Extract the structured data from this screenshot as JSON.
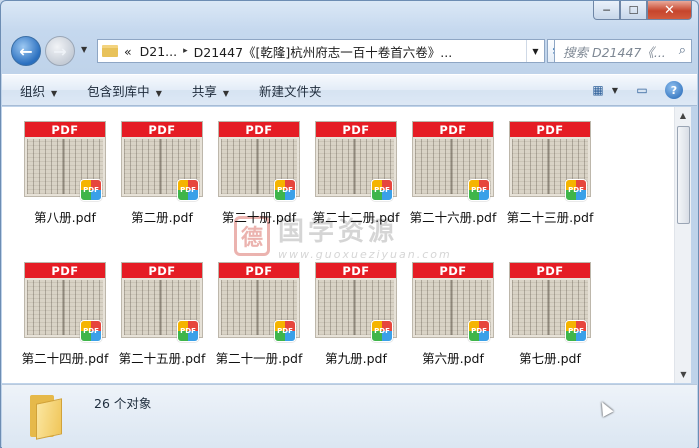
{
  "window": {
    "minimize": "─",
    "maximize": "☐",
    "close": "✕"
  },
  "nav": {
    "back_glyph": "←",
    "forward_glyph": "→",
    "history_dropdown": "▼",
    "breadcrumb": {
      "overflow": "«",
      "crumb1": "D21...",
      "crumb2": "D21447《[乾隆]杭州府志一百十卷首六卷》...",
      "separator": "▸"
    },
    "address_dropdown": "▼",
    "refresh_glyph": "⇆",
    "search_placeholder": "搜索 D21447《...",
    "search_icon": "⌕"
  },
  "toolbar": {
    "organize": "组织",
    "include_library": "包含到库中",
    "share": "共享",
    "new_folder": "新建文件夹",
    "dropdown_arrow": "▼",
    "view_icon": "▦",
    "view_dropdown": "▼",
    "pane_icon": "▭",
    "help_icon": "?"
  },
  "files": [
    {
      "name": "第八册.pdf"
    },
    {
      "name": "第二册.pdf"
    },
    {
      "name": "第二十册.pdf"
    },
    {
      "name": "第二十二册.pdf"
    },
    {
      "name": "第二十六册.pdf"
    },
    {
      "name": "第二十三册.pdf"
    },
    {
      "name": "第二十四册.pdf"
    },
    {
      "name": "第二十五册.pdf"
    },
    {
      "name": "第二十一册.pdf"
    },
    {
      "name": "第九册.pdf"
    },
    {
      "name": "第六册.pdf"
    },
    {
      "name": "第七册.pdf"
    }
  ],
  "thumbnail_band": "PDF",
  "pdf_badge": "PDF",
  "watermark": {
    "seal": "德",
    "name": "国学资源",
    "url": "www.guoxueziyuan.com"
  },
  "scrollbar": {
    "up": "▲",
    "down": "▼"
  },
  "status": {
    "count_text": "26 个对象"
  },
  "colors": {
    "pdf_red": "#e51c24",
    "accent_blue": "#2a6fbf"
  }
}
